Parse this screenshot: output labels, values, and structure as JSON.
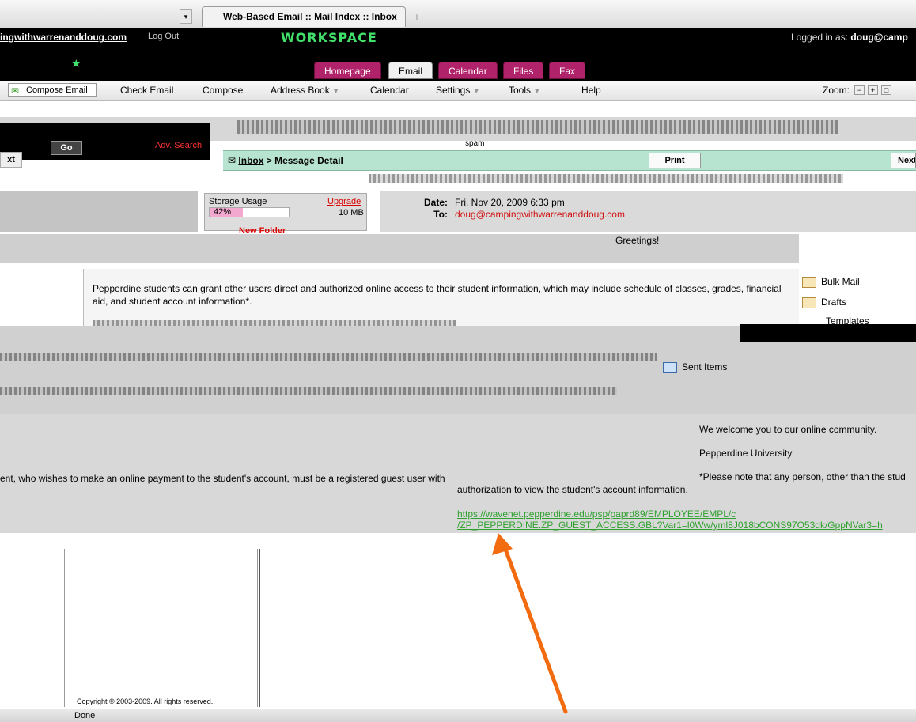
{
  "browser": {
    "tab_title": "Web-Based Email :: Mail Index :: Inbox",
    "new_tab": "+",
    "status": "Done"
  },
  "header": {
    "site": "ingwithwarrenanddoug.com",
    "logout": "Log Out",
    "logo": "WORKSPACE",
    "logged_in_label": "Logged in as:",
    "user": "doug@camp"
  },
  "app_tabs": [
    "Homepage",
    "Email",
    "Calendar",
    "Files",
    "Fax"
  ],
  "toolbar": {
    "compose_email": "Compose Email",
    "check_email": "Check Email",
    "compose": "Compose",
    "address_book": "Address Book",
    "calendar": "Calendar",
    "settings": "Settings",
    "tools": "Tools",
    "help": "Help",
    "zoom": "Zoom:",
    "zoom_buttons": [
      "−",
      "+",
      "□"
    ]
  },
  "search": {
    "go": "Go",
    "adv_search": "Adv. Search",
    "spam": "spam"
  },
  "message": {
    "next_left": "xt",
    "breadcrumb_link": "Inbox",
    "breadcrumb_tail": " > Message Detail",
    "print": "Print",
    "next_right": "Next",
    "date_label": "Date:",
    "date_value": "Fri, Nov 20, 2009 6:33 pm",
    "to_label": "To:",
    "to_value": "doug@campingwithwarrenanddoug.com",
    "greeting": "Greetings!",
    "paragraph": "Pepperdine students can grant other users direct and authorized online access to their student information, which may include schedule of classes, grades, financial aid, and student account information*.",
    "welcome": "We welcome you to our online community.",
    "signature": "Pepperdine University",
    "note": "*Please note that any person, other than the stud",
    "payment": "ent, who wishes to make an online payment to the student's account, must be a registered guest user with",
    "authorization": "authorization to view the student's account information.",
    "url1": "https://wavenet.pepperdine.edu/psp/paprd89/EMPLOYEE/EMPL/c",
    "url2": "/ZP_PEPPERDINE.ZP_GUEST_ACCESS.GBL?Var1=l0Ww/yml8J018bCONS97O53dk/GppNVar3=h"
  },
  "storage": {
    "label": "Storage Usage",
    "upgrade": "Upgrade",
    "percent": 42,
    "percent_text": "42%",
    "size": "10 MB"
  },
  "folders": {
    "new_folder": "New Folder",
    "bulk_mail": "Bulk Mail",
    "drafts": "Drafts",
    "templates": "Templates",
    "sent_items": "Sent Items"
  },
  "footer": {
    "copyright": "Copyright © 2003-2009. All rights reserved."
  },
  "colors": {
    "app_tab": "#b0226a",
    "msg_bar": "#b7e3d1",
    "link_green": "#2ea12e",
    "arrow": "#f26b0f"
  }
}
